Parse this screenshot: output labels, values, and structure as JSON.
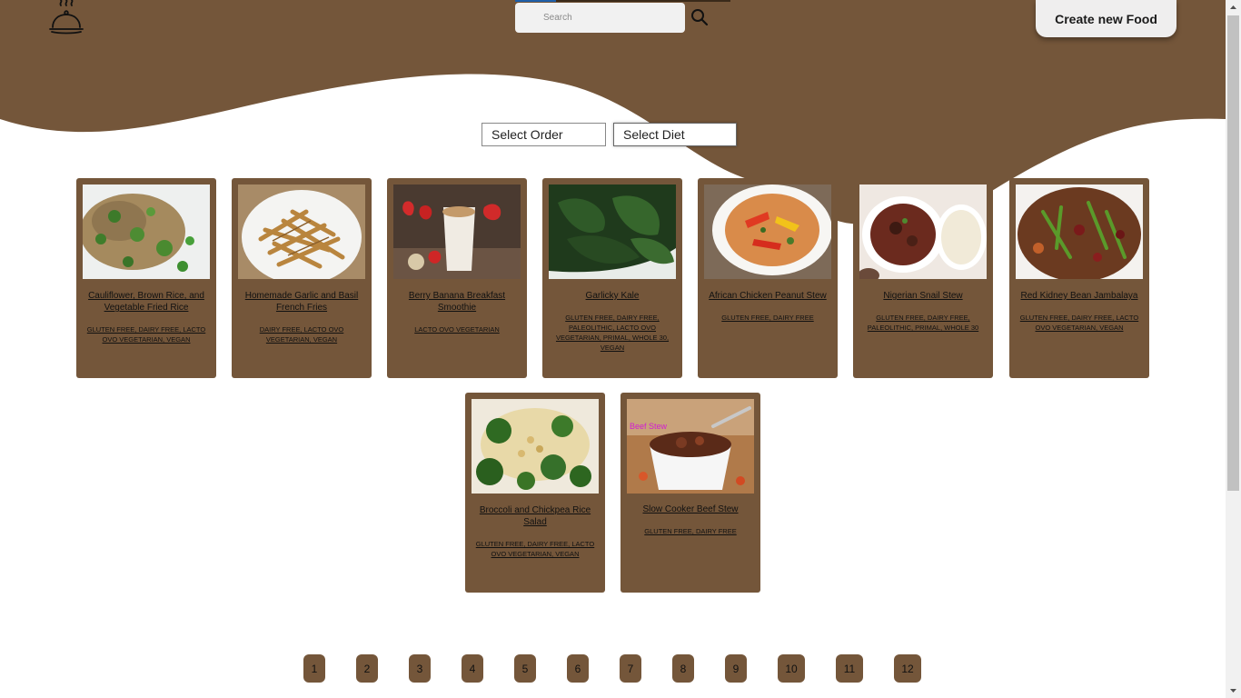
{
  "header": {
    "search_placeholder": "Search",
    "create_label": "Create new Food"
  },
  "filters": {
    "order_label": "Select Order",
    "diet_label": "Select Diet"
  },
  "colors": {
    "brand_brown": "#74563a",
    "page_bg": "#ffffff"
  },
  "recipes": [
    {
      "title": "Cauliflower, Brown Rice, and Vegetable Fried Rice",
      "diets": "GLUTEN FREE, DAIRY FREE, LACTO OVO VEGETARIAN, VEGAN",
      "image": "fried-rice-photo"
    },
    {
      "title": "Homemade Garlic and Basil French Fries",
      "diets": "DAIRY FREE, LACTO OVO VEGETARIAN, VEGAN",
      "image": "french-fries-photo"
    },
    {
      "title": "Berry Banana Breakfast Smoothie",
      "diets": "LACTO OVO VEGETARIAN",
      "image": "smoothie-photo"
    },
    {
      "title": "Garlicky Kale",
      "diets": "GLUTEN FREE, DAIRY FREE, PALEOLITHIC, LACTO OVO VEGETARIAN, PRIMAL, WHOLE 30, VEGAN",
      "image": "kale-photo"
    },
    {
      "title": "African Chicken Peanut Stew",
      "diets": "GLUTEN FREE, DAIRY FREE",
      "image": "peanut-stew-photo"
    },
    {
      "title": "Nigerian Snail Stew",
      "diets": "GLUTEN FREE, DAIRY FREE, PALEOLITHIC, PRIMAL, WHOLE 30",
      "image": "snail-stew-photo"
    },
    {
      "title": "Red Kidney Bean Jambalaya",
      "diets": "GLUTEN FREE, DAIRY FREE, LACTO OVO VEGETARIAN, VEGAN",
      "image": "jambalaya-photo"
    },
    {
      "title": "Broccoli and Chickpea Rice Salad",
      "diets": "GLUTEN FREE, DAIRY FREE, LACTO OVO VEGETARIAN, VEGAN",
      "image": "broccoli-salad-photo"
    },
    {
      "title": "Slow Cooker Beef Stew",
      "diets": "GLUTEN FREE, DAIRY FREE",
      "image": "beef-stew-photo",
      "photo_caption": "Beef Stew"
    }
  ],
  "pagination": {
    "pages": [
      "1",
      "2",
      "3",
      "4",
      "5",
      "6",
      "7",
      "8",
      "9",
      "10",
      "11",
      "12"
    ]
  }
}
